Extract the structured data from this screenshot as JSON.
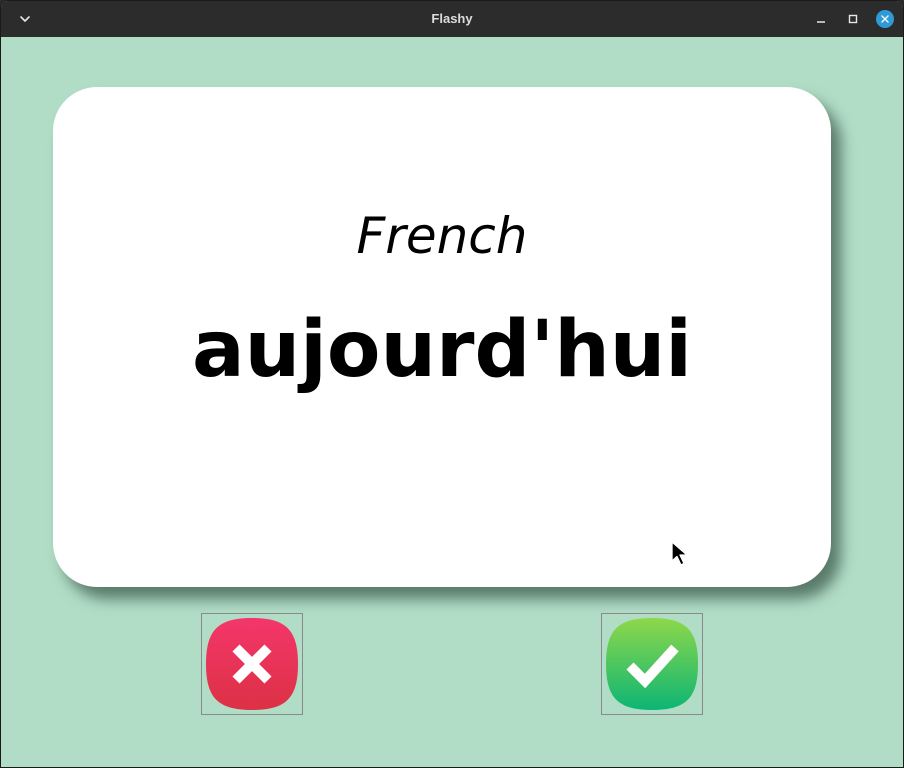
{
  "window": {
    "title": "Flashy",
    "menu_icon": "chevron-down-icon",
    "minimize_icon": "minimize-icon",
    "maximize_icon": "maximize-icon",
    "close_icon": "close-icon"
  },
  "colors": {
    "background": "#B1DDC6",
    "card": "#FFFFFF",
    "titlebar": "#2C2C2C",
    "close_accent": "#2E9BD6",
    "wrong_button": "#E8304F",
    "right_button": "#35C25C"
  },
  "card": {
    "title": "French",
    "word": "aujourd'hui"
  },
  "buttons": {
    "wrong_icon": "cross-icon",
    "right_icon": "checkmark-icon"
  }
}
